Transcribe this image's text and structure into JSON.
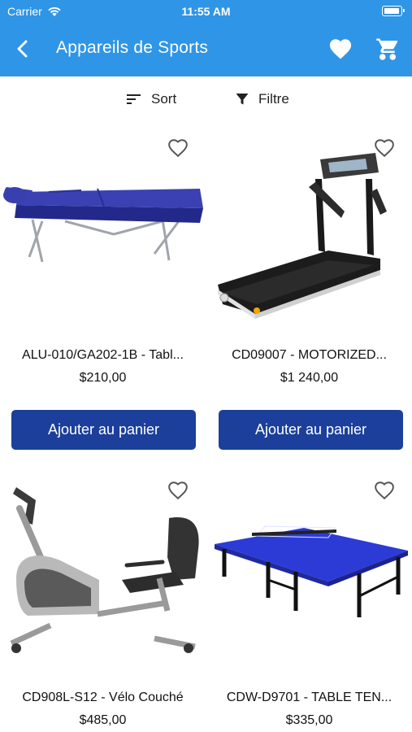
{
  "status_bar": {
    "carrier": "Carrier",
    "time": "11:55 AM"
  },
  "nav": {
    "title": "Appareils de Sports",
    "back_icon": "chevron-left-icon",
    "favorites_icon": "heart-icon",
    "cart_icon": "cart-icon"
  },
  "toolbar": {
    "sort_label": "Sort",
    "filter_label": "Filtre"
  },
  "colors": {
    "header": "#2f95e6",
    "button": "#1b3f9a",
    "text": "#111111"
  },
  "products": [
    {
      "name": "ALU-010/GA202-1B - Tabl...",
      "price": "$210,00",
      "button_label": "Ajouter au panier"
    },
    {
      "name": "CD09007 - MOTORIZED...",
      "price": "$1 240,00",
      "button_label": "Ajouter au panier"
    },
    {
      "name": "CD908L-S12 - Vélo Couché",
      "price": "$485,00"
    },
    {
      "name": "CDW-D9701 - TABLE TEN...",
      "price": "$335,00"
    }
  ]
}
